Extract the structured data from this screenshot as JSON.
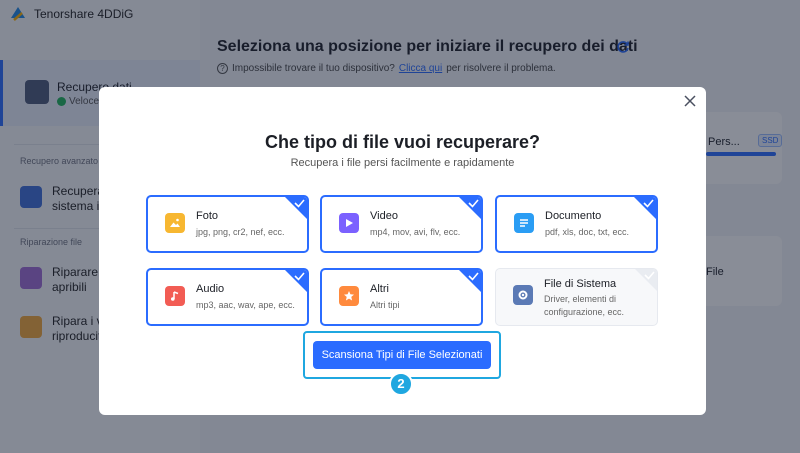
{
  "app": {
    "name": "Tenorshare 4DDiG"
  },
  "sidebar": {
    "active_item": {
      "title": "Recupero dati",
      "subtitle": "Veloce e"
    },
    "section_advanced": "Recupero avanzato",
    "advanced_item": "Recupera\nsistema in",
    "section_repair": "Riparazione file",
    "repair_item_1": "Riparare l\napribili",
    "repair_item_2": "Ripara i vi\nriproducit"
  },
  "main": {
    "title": "Seleziona una posizione per iniziare il recupero dei dati",
    "help_text": "Impossibile trovare il tuo dispositivo?",
    "help_link": "Clicca qui",
    "help_suffix": "per risolvere il problema.",
    "drive_name": "Pers...",
    "drive_badge": "SSD",
    "drive2_name": "File"
  },
  "modal": {
    "title": "Che tipo di file vuoi recuperare?",
    "subtitle": "Recupera i file persi facilmente e rapidamente",
    "cards": [
      {
        "name": "Foto",
        "desc": "jpg, png, cr2, nef, ecc.",
        "icon": "photo-icon",
        "color": "#f7b731",
        "checked": true
      },
      {
        "name": "Video",
        "desc": "mp4, mov, avi, flv, ecc.",
        "icon": "video-icon",
        "color": "#7b61ff",
        "checked": true
      },
      {
        "name": "Documento",
        "desc": "pdf, xls, doc, txt, ecc.",
        "icon": "document-icon",
        "color": "#2a9df4",
        "checked": true
      },
      {
        "name": "Audio",
        "desc": "mp3, aac, wav, ape, ecc.",
        "icon": "audio-icon",
        "color": "#f25c54",
        "checked": true
      },
      {
        "name": "Altri",
        "desc": "Altri tipi",
        "icon": "star-icon",
        "color": "#ff8a3d",
        "checked": true
      },
      {
        "name": "File di Sistema",
        "desc": "Driver, elementi di\nconfigurazione, ecc.",
        "icon": "gear-icon",
        "color": "#5b7ab5",
        "checked": false
      }
    ],
    "scan_button": "Scansiona Tipi di File Selezionati",
    "step": "2"
  },
  "colors": {
    "accent": "#2b6cff",
    "highlight": "#1fa7e0"
  }
}
